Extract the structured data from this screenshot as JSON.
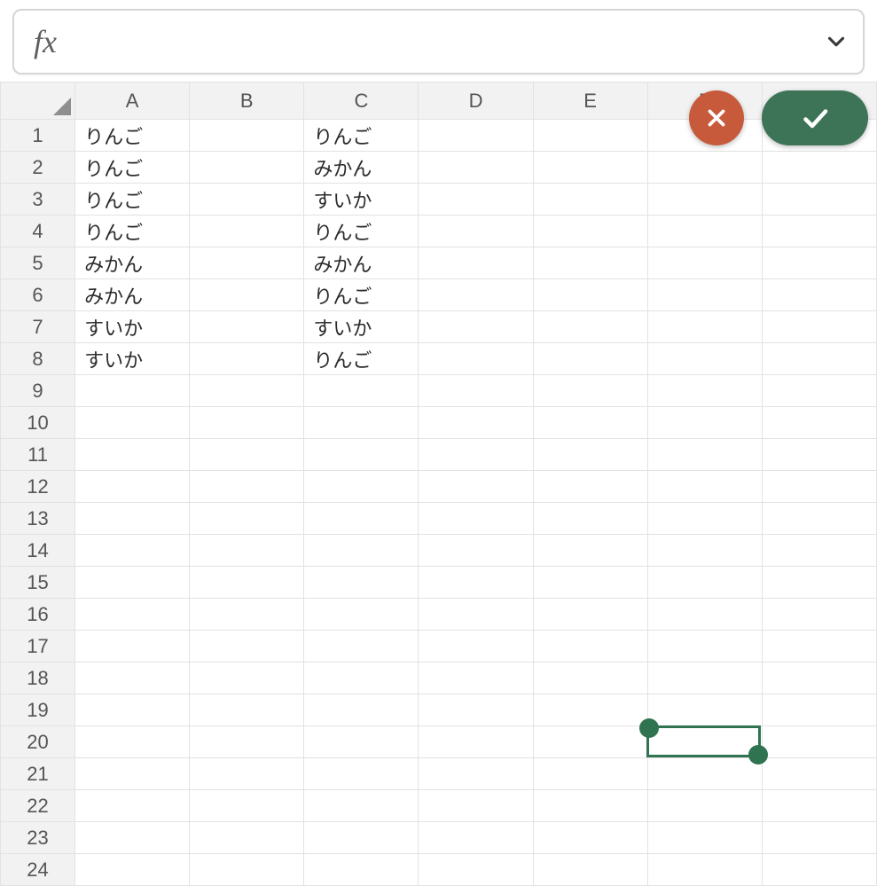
{
  "formula_bar": {
    "fx_label": "fx",
    "value": ""
  },
  "columns": [
    "A",
    "B",
    "C",
    "D",
    "E",
    "F",
    "G"
  ],
  "row_count": 24,
  "active_column_index": 5,
  "active_row": 20,
  "cells": {
    "A1": "りんご",
    "A2": "りんご",
    "A3": "りんご",
    "A4": "りんご",
    "A5": "みかん",
    "A6": "みかん",
    "A7": "すいか",
    "A8": "すいか",
    "C1": "りんご",
    "C2": "みかん",
    "C3": "すいか",
    "C4": "りんご",
    "C5": "みかん",
    "C6": "りんご",
    "C7": "すいか",
    "C8": "りんご"
  },
  "colors": {
    "accent": "#2f7350",
    "cancel": "#c85a3c"
  }
}
